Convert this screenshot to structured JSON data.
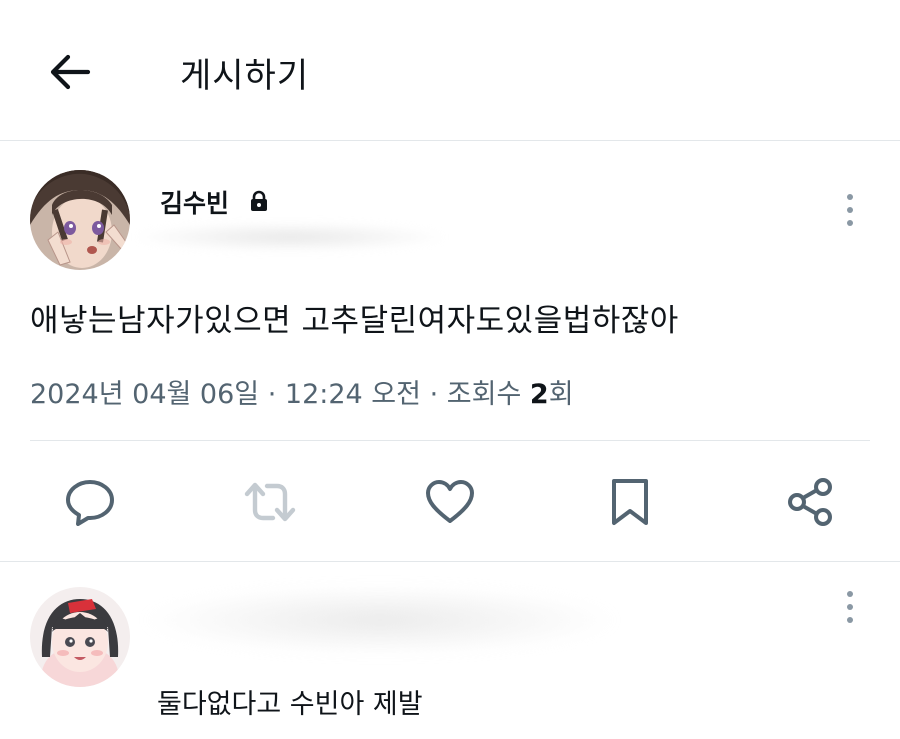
{
  "header": {
    "title": "게시하기",
    "back_icon": "arrow-left-icon"
  },
  "post": {
    "author_name": "김수빈",
    "protected_icon": "lock-icon",
    "text": "애낳는남자가있으면 고추달린여자도있을법하잖아",
    "date": "2024년 04월 06일",
    "time": "12:24 오전",
    "views_label": "조회수",
    "views_count": "2",
    "views_unit": "회",
    "separator": "·"
  },
  "actions": [
    "reply-icon",
    "retweet-icon",
    "like-icon",
    "bookmark-icon",
    "share-icon"
  ],
  "reply": {
    "text": "둘다없다고 수빈아 제발"
  },
  "colors": {
    "text": "#0f1419",
    "secondary": "#536471",
    "divider": "#e3e7ea",
    "icon": "#536471"
  }
}
